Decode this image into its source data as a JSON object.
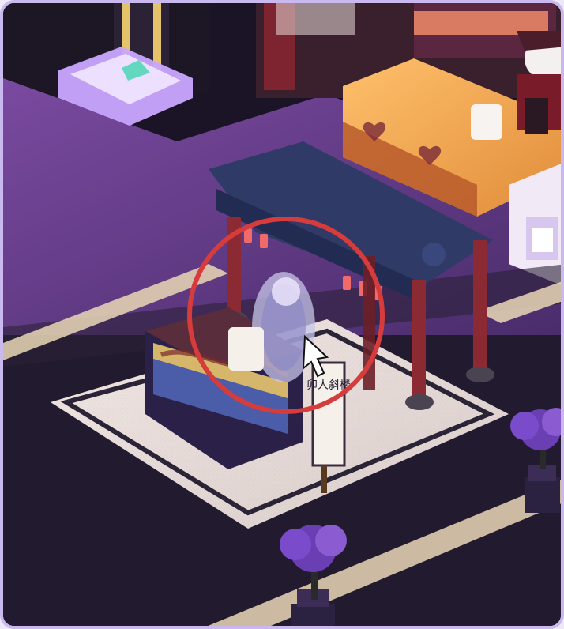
{
  "scene": {
    "sign_text": "卯人斜楼"
  },
  "colors": {
    "frame_border": "#c9b9ee",
    "floor_purple": "#7a4aa0",
    "floor_dark": "#221a2e",
    "highlight_circle": "#d63c3c",
    "canopy": "#2f3a66",
    "counter_orange": "#f0a24a",
    "pillar_red": "#8b2a33"
  },
  "icons": {
    "cursor": "cursor-icon",
    "circle": "highlight-circle"
  }
}
